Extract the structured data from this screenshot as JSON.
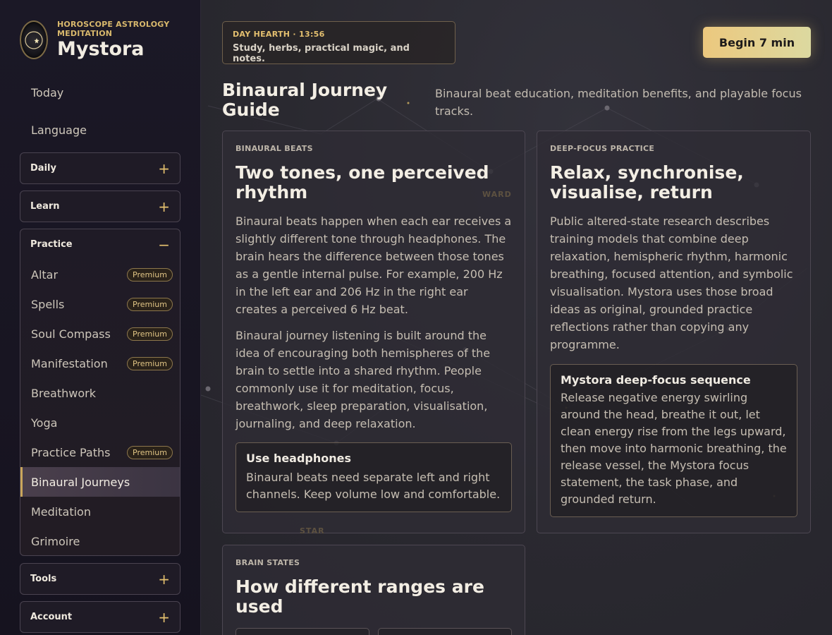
{
  "brand": {
    "tagline": "HOROSCOPE ASTROLOGY MEDITATION",
    "name": "Mystora"
  },
  "sidebar": {
    "plain": [
      "Today",
      "Language"
    ],
    "groups": [
      {
        "label": "Daily",
        "toggle": "+"
      },
      {
        "label": "Learn",
        "toggle": "+"
      },
      {
        "label": "Practice",
        "toggle": "−"
      },
      {
        "label": "Tools",
        "toggle": "+"
      },
      {
        "label": "Account",
        "toggle": "+"
      }
    ],
    "practice_items": [
      {
        "label": "Altar",
        "badge": "Premium"
      },
      {
        "label": "Spells",
        "badge": "Premium"
      },
      {
        "label": "Soul Compass",
        "badge": "Premium"
      },
      {
        "label": "Manifestation",
        "badge": "Premium"
      },
      {
        "label": "Breathwork",
        "badge": ""
      },
      {
        "label": "Yoga",
        "badge": ""
      },
      {
        "label": "Practice Paths",
        "badge": "Premium"
      },
      {
        "label": "Binaural Journeys",
        "badge": ""
      },
      {
        "label": "Meditation",
        "badge": ""
      },
      {
        "label": "Grimoire",
        "badge": ""
      }
    ],
    "active_item": "Binaural Journeys"
  },
  "header": {
    "badge_label": "DAY HEARTH · 13:56",
    "badge_sub": "Study, herbs, practical magic, and notes.",
    "cta": "Begin 7 min"
  },
  "page": {
    "title": "Binaural Journey Guide",
    "description": "Binaural beat education, meditation benefits, and playable focus tracks."
  },
  "cards": {
    "beats": {
      "eyebrow": "BINAURAL BEATS",
      "title": "Two tones, one perceived rhythm",
      "p1": "Binaural beats happen when each ear receives a slightly different tone through headphones. The brain hears the difference between those tones as a gentle internal pulse. For example, 200 Hz in the left ear and 206 Hz in the right ear creates a perceived 6 Hz beat.",
      "p2": "Binaural journey listening is built around the idea of encouraging both hemispheres of the brain to settle into a shared rhythm. People commonly use it for meditation, focus, breathwork, sleep preparation, visualisation, journaling, and deep relaxation.",
      "inset_title": "Use headphones",
      "inset_text": "Binaural beats need separate left and right channels. Keep volume low and comfortable."
    },
    "focus": {
      "eyebrow": "DEEP-FOCUS PRACTICE",
      "title": "Relax, synchronise, visualise, return",
      "p1": "Public altered-state research describes training models that combine deep relaxation, hemispheric rhythm, harmonic breathing, focused attention, and symbolic visualisation. Mystora uses those broad ideas as original, grounded practice reflections rather than copying any programme.",
      "inset_title": "Mystora deep-focus sequence",
      "inset_text": "Release negative energy swirling around the head, breathe it out, let clean energy rise from the legs upward, then move into harmonic breathing, the release vessel, the Mystora focus statement, the task phase, and grounded return."
    },
    "states": {
      "eyebrow": "BRAIN STATES",
      "title": "How different ranges are used"
    }
  },
  "decor": {
    "faint_word_1": "WARD",
    "faint_word_2": "STAR"
  }
}
